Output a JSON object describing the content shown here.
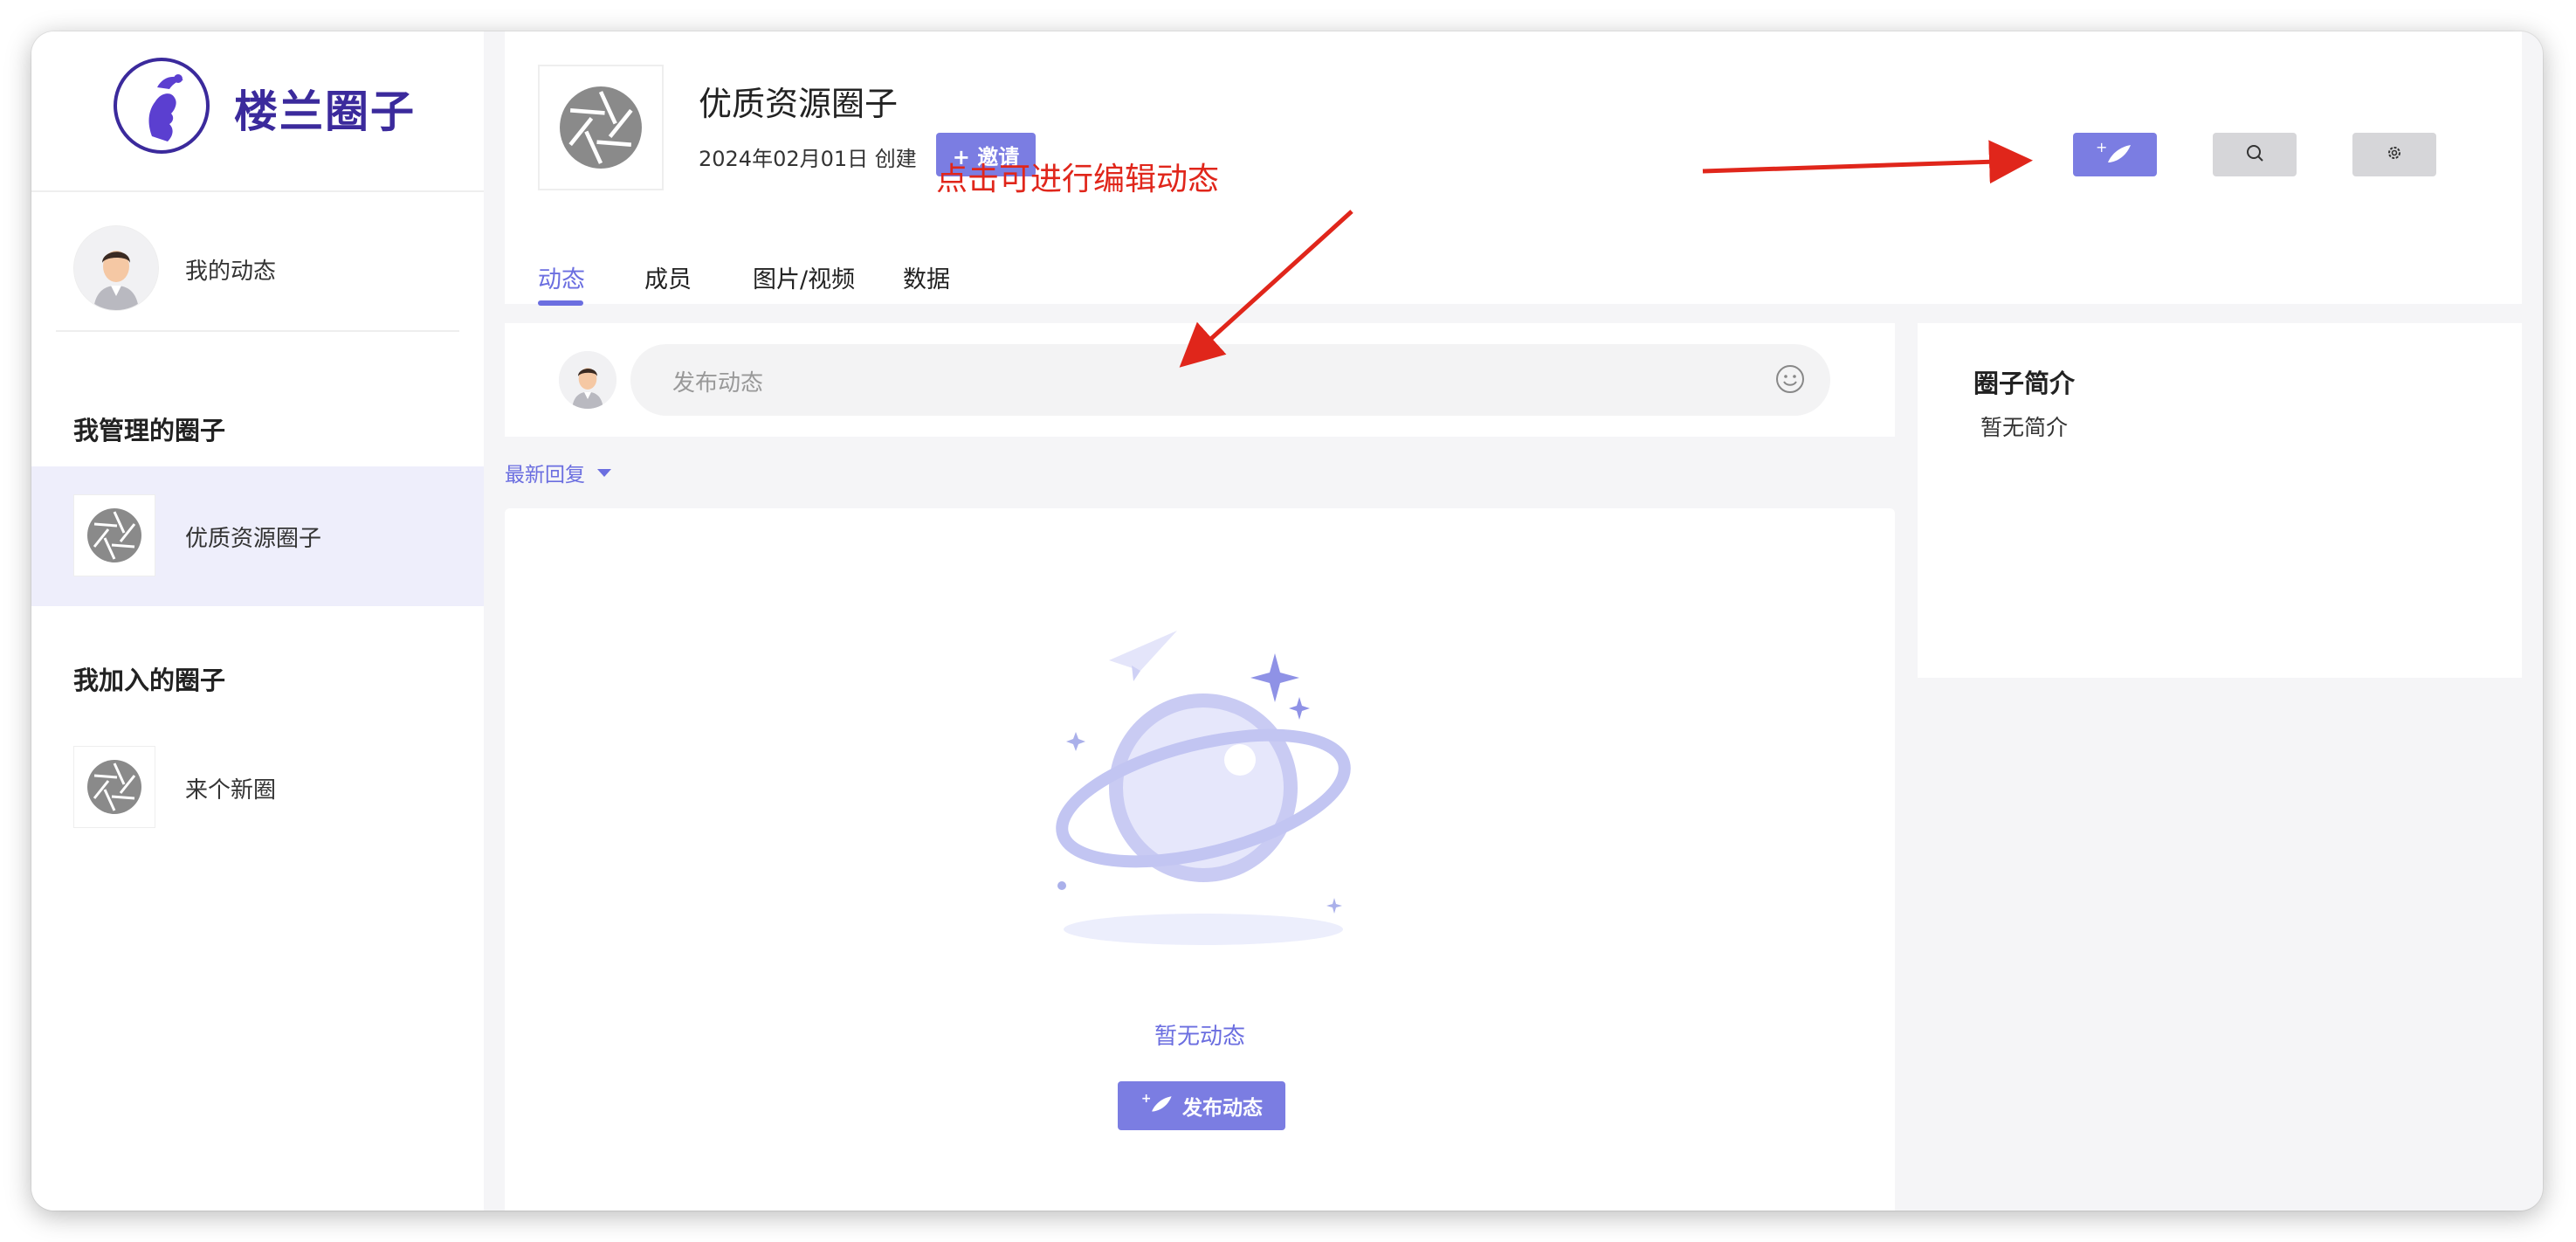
{
  "brand": {
    "name": "楼兰圈子"
  },
  "sidebar": {
    "my_feed_label": "我的动态",
    "managed_title": "我管理的圈子",
    "managed_items": [
      {
        "label": "优质资源圈子"
      }
    ],
    "joined_title": "我加入的圈子",
    "joined_items": [
      {
        "label": "来个新圈"
      }
    ]
  },
  "header": {
    "title": "优质资源圈子",
    "created": "2024年02月01日 创建",
    "invite_label": "+ 邀请",
    "tabs": [
      {
        "label": "动态"
      },
      {
        "label": "成员"
      },
      {
        "label": "图片/视频"
      },
      {
        "label": "数据"
      }
    ],
    "active_tab": "动态"
  },
  "annotation": {
    "text": "点击可进行编辑动态",
    "color": "#e0261b"
  },
  "composer": {
    "placeholder": "发布动态"
  },
  "sort": {
    "label": "最新回复"
  },
  "feed": {
    "empty_text": "暂无动态",
    "post_button": "发布动态"
  },
  "intro": {
    "title": "圈子简介",
    "body": "暂无简介"
  },
  "colors": {
    "accent": "#7b7de2",
    "brand": "#3b2a9c"
  },
  "icons": {
    "edit": "quill-plus-icon",
    "search": "search-icon",
    "settings": "gear-icon",
    "emoji": "smiley-icon"
  }
}
